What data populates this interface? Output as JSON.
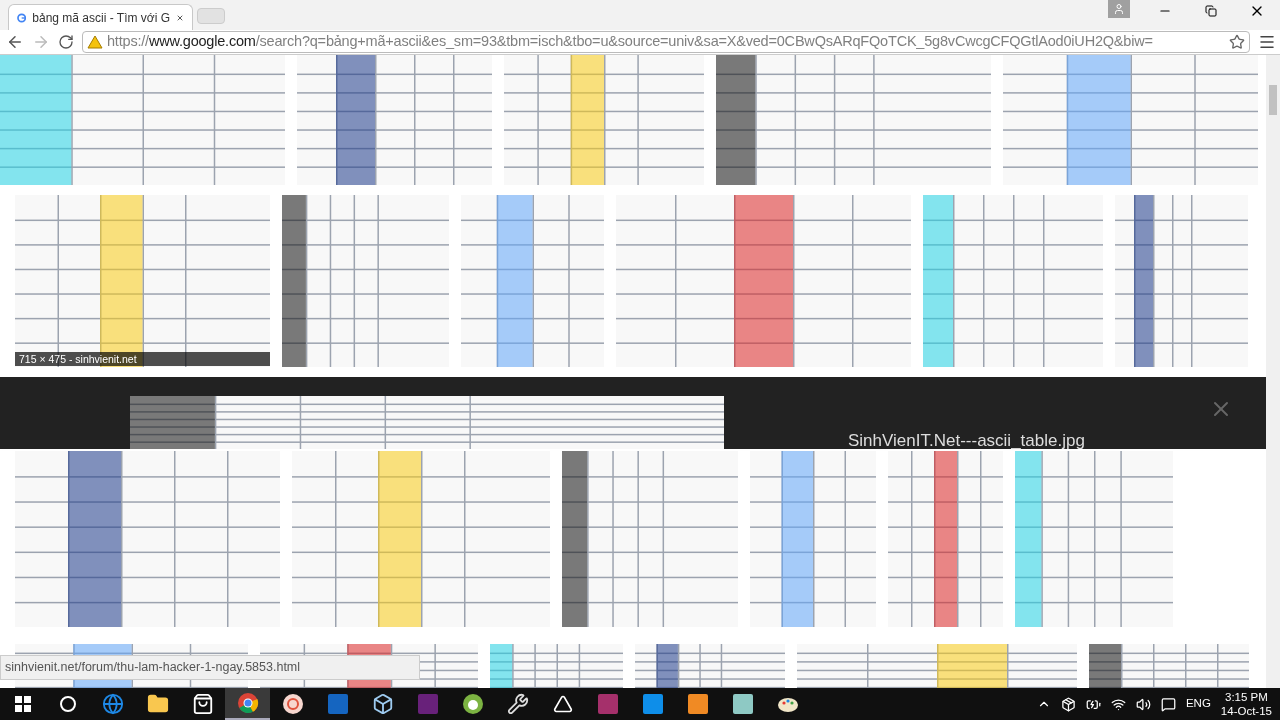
{
  "browser": {
    "tab": {
      "title": "bảng mã ascii - Tìm với G",
      "selected": true
    },
    "address": {
      "scheme": "https://",
      "host": "www.google.com",
      "path": "/search?q=bảng+mã+ascii&es_sm=93&tbm=isch&tbo=u&source=univ&sa=X&ved=0CBwQsARqFQoTCK_5g8vCwcgCFQGtlAod0iUH2Q&biw="
    }
  },
  "results": {
    "hover_caption": "715 × 475 - sinhvienit.net",
    "preview": {
      "title": "SinhVienIT.Net---ascii_table.jpg"
    }
  },
  "status_bar": {
    "url": "sinhvienit.net/forum/thu-lam-hacker-1-ngay.5853.html"
  },
  "taskbar": {
    "apps": [
      {
        "kind": "start",
        "selected": false
      },
      {
        "kind": "cortana",
        "selected": false
      },
      {
        "kind": "edge",
        "selected": false
      },
      {
        "kind": "folder",
        "selected": false
      },
      {
        "kind": "store",
        "selected": false
      },
      {
        "kind": "chrome",
        "selected": true
      },
      {
        "kind": "ring",
        "selected": false
      },
      {
        "kind": "dev",
        "selected": false
      },
      {
        "kind": "cube",
        "selected": false
      },
      {
        "kind": "studio",
        "selected": false
      },
      {
        "kind": "android",
        "selected": false
      },
      {
        "kind": "tools",
        "selected": false
      },
      {
        "kind": "unity",
        "selected": false
      },
      {
        "kind": "purple",
        "selected": false
      },
      {
        "kind": "teamviewer",
        "selected": false
      },
      {
        "kind": "orange",
        "selected": false
      },
      {
        "kind": "notepad",
        "selected": false
      },
      {
        "kind": "paint",
        "selected": false
      }
    ],
    "language": "ENG",
    "time": "3:15 PM",
    "date": "14-Oct-15"
  }
}
